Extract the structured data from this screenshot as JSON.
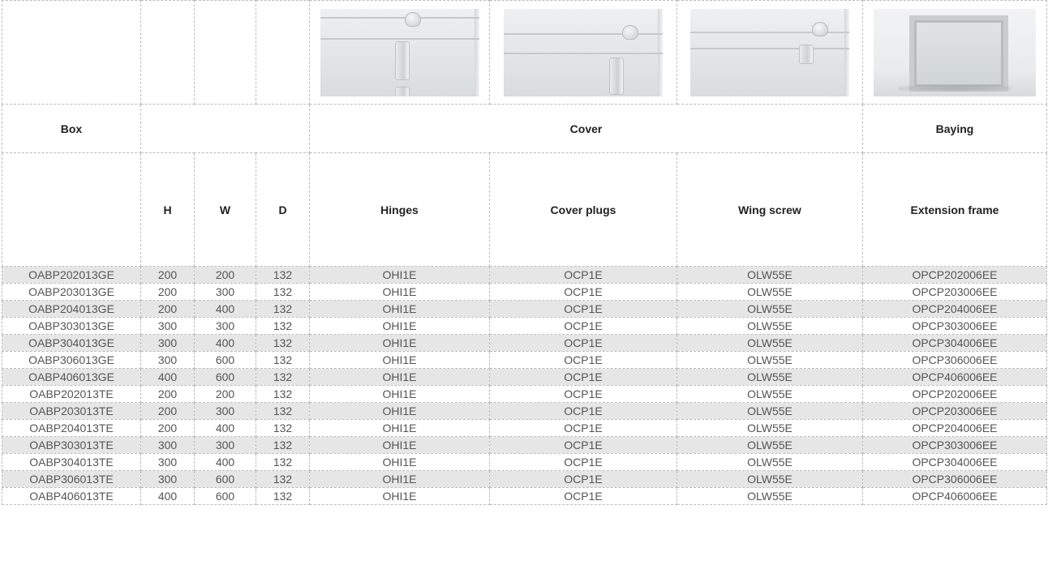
{
  "headers": {
    "groups": {
      "box": "Box",
      "cover": "Cover",
      "baying": "Baying"
    },
    "columns": {
      "h": "H",
      "w": "W",
      "d": "D",
      "hinges": "Hinges",
      "cover_plugs": "Cover plugs",
      "wing_screw": "Wing screw",
      "extension_frame": "Extension frame"
    }
  },
  "images": {
    "hinges": "hinge-photo",
    "cover_plugs": "cover-plug-photo",
    "wing_screw": "wing-screw-photo",
    "extension_frame": "extension-frame-photo"
  },
  "rows": [
    {
      "box": "OABP202013GE",
      "h": "200",
      "w": "200",
      "d": "132",
      "hinges": "OHI1E",
      "cover_plugs": "OCP1E",
      "wing_screw": "OLW55E",
      "extension_frame": "OPCP202006EE"
    },
    {
      "box": "OABP203013GE",
      "h": "200",
      "w": "300",
      "d": "132",
      "hinges": "OHI1E",
      "cover_plugs": "OCP1E",
      "wing_screw": "OLW55E",
      "extension_frame": "OPCP203006EE"
    },
    {
      "box": "OABP204013GE",
      "h": "200",
      "w": "400",
      "d": "132",
      "hinges": "OHI1E",
      "cover_plugs": "OCP1E",
      "wing_screw": "OLW55E",
      "extension_frame": "OPCP204006EE"
    },
    {
      "box": "OABP303013GE",
      "h": "300",
      "w": "300",
      "d": "132",
      "hinges": "OHI1E",
      "cover_plugs": "OCP1E",
      "wing_screw": "OLW55E",
      "extension_frame": "OPCP303006EE"
    },
    {
      "box": "OABP304013GE",
      "h": "300",
      "w": "400",
      "d": "132",
      "hinges": "OHI1E",
      "cover_plugs": "OCP1E",
      "wing_screw": "OLW55E",
      "extension_frame": "OPCP304006EE"
    },
    {
      "box": "OABP306013GE",
      "h": "300",
      "w": "600",
      "d": "132",
      "hinges": "OHI1E",
      "cover_plugs": "OCP1E",
      "wing_screw": "OLW55E",
      "extension_frame": "OPCP306006EE"
    },
    {
      "box": "OABP406013GE",
      "h": "400",
      "w": "600",
      "d": "132",
      "hinges": "OHI1E",
      "cover_plugs": "OCP1E",
      "wing_screw": "OLW55E",
      "extension_frame": "OPCP406006EE"
    },
    {
      "box": "OABP202013TE",
      "h": "200",
      "w": "200",
      "d": "132",
      "hinges": "OHI1E",
      "cover_plugs": "OCP1E",
      "wing_screw": "OLW55E",
      "extension_frame": "OPCP202006EE"
    },
    {
      "box": "OABP203013TE",
      "h": "200",
      "w": "300",
      "d": "132",
      "hinges": "OHI1E",
      "cover_plugs": "OCP1E",
      "wing_screw": "OLW55E",
      "extension_frame": "OPCP203006EE"
    },
    {
      "box": "OABP204013TE",
      "h": "200",
      "w": "400",
      "d": "132",
      "hinges": "OHI1E",
      "cover_plugs": "OCP1E",
      "wing_screw": "OLW55E",
      "extension_frame": "OPCP204006EE"
    },
    {
      "box": "OABP303013TE",
      "h": "300",
      "w": "300",
      "d": "132",
      "hinges": "OHI1E",
      "cover_plugs": "OCP1E",
      "wing_screw": "OLW55E",
      "extension_frame": "OPCP303006EE"
    },
    {
      "box": "OABP304013TE",
      "h": "300",
      "w": "400",
      "d": "132",
      "hinges": "OHI1E",
      "cover_plugs": "OCP1E",
      "wing_screw": "OLW55E",
      "extension_frame": "OPCP304006EE"
    },
    {
      "box": "OABP306013TE",
      "h": "300",
      "w": "600",
      "d": "132",
      "hinges": "OHI1E",
      "cover_plugs": "OCP1E",
      "wing_screw": "OLW55E",
      "extension_frame": "OPCP306006EE"
    },
    {
      "box": "OABP406013TE",
      "h": "400",
      "w": "600",
      "d": "132",
      "hinges": "OHI1E",
      "cover_plugs": "OCP1E",
      "wing_screw": "OLW55E",
      "extension_frame": "OPCP406006EE"
    }
  ],
  "colors": {
    "border": "#bdbdbd",
    "row_shade": "#e6e6e6",
    "header_text": "#222222",
    "body_text": "#555555"
  }
}
